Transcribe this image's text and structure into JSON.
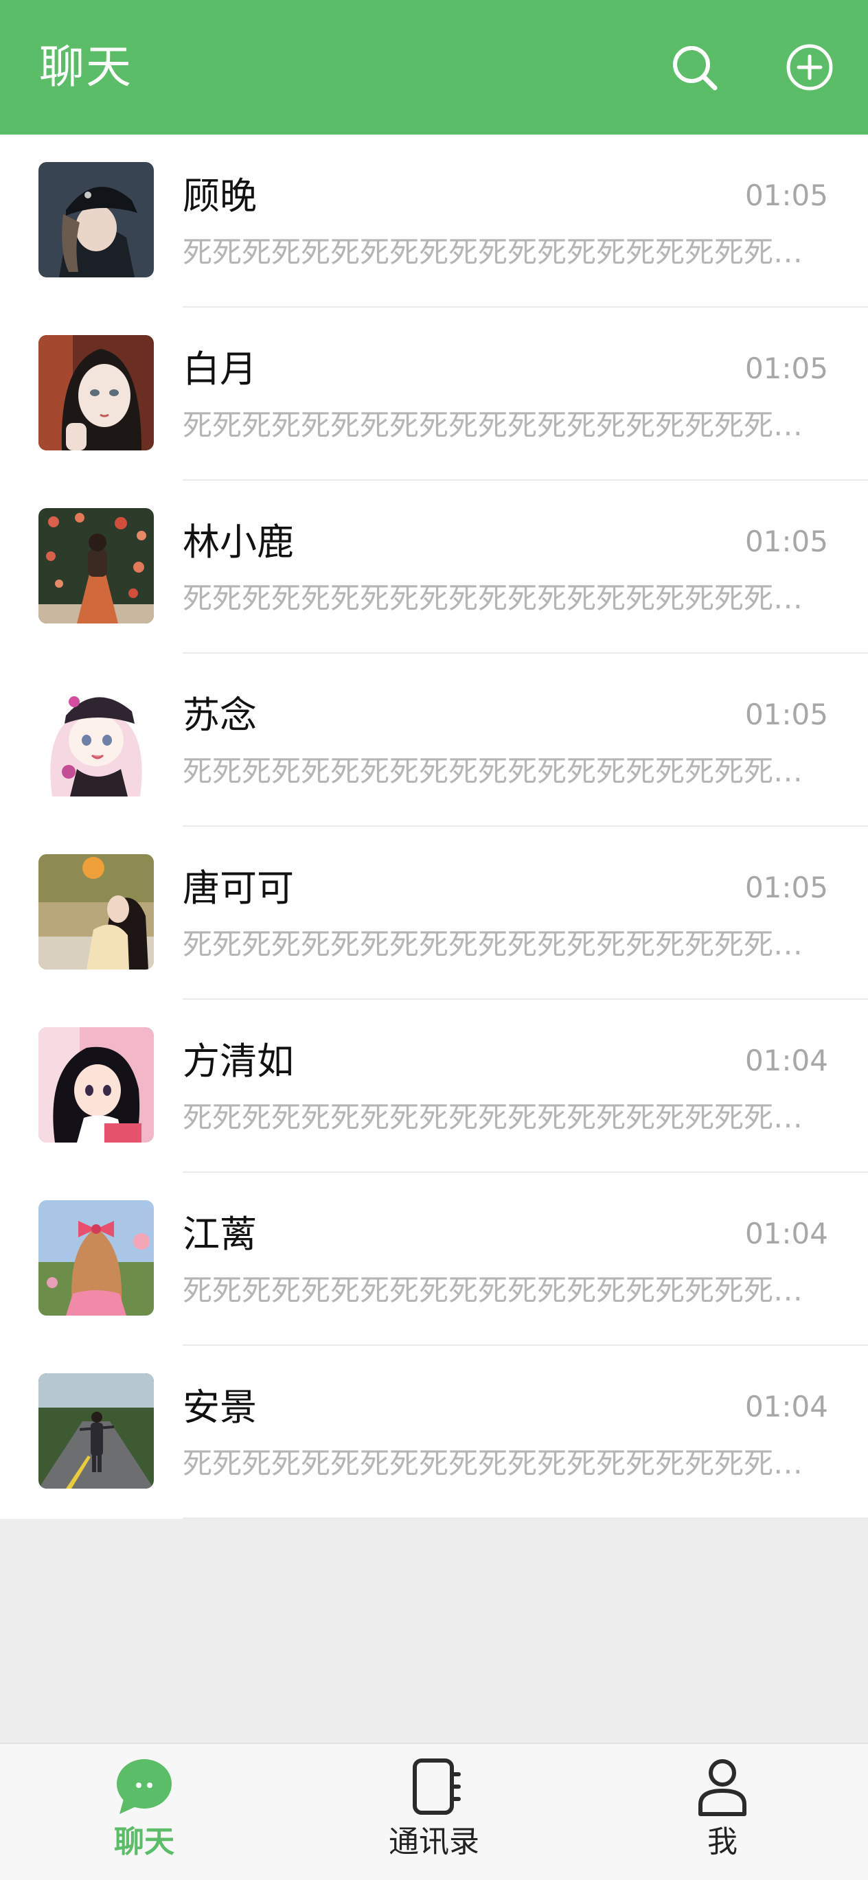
{
  "header": {
    "title": "聊天",
    "search_icon": "search-icon",
    "add_icon": "plus-circle-icon"
  },
  "chats": [
    {
      "name": "顾晚",
      "time": "01:05",
      "preview": "死死死死死死死死死死死死死死死死死死死死死死死死死死死死死死",
      "avatar": "avatar-girl-black-cap"
    },
    {
      "name": "白月",
      "time": "01:05",
      "preview": "死死死死死死死死死死死死死死死死死死死死死死死死死死死死死死",
      "avatar": "avatar-girl-illustration"
    },
    {
      "name": "林小鹿",
      "time": "01:05",
      "preview": "死死死死死死死死死死死死死死死死死死死死死死死死死死死死死死",
      "avatar": "avatar-girl-flowers"
    },
    {
      "name": "苏念",
      "time": "01:05",
      "preview": "死死死死死死死死死死死死死死死死死死死死死死死死死死死死死死",
      "avatar": "avatar-anime-girl-cap"
    },
    {
      "name": "唐可可",
      "time": "01:05",
      "preview": "死死死死死死死死死死死死死死死死死死死死死死死死死死死死死死",
      "avatar": "avatar-girl-autumn"
    },
    {
      "name": "方清如",
      "time": "01:04",
      "preview": "死死死死死死死死死死死死死死死死死死死死死死死死死死死死死死",
      "avatar": "avatar-anime-girl-pink"
    },
    {
      "name": "江蓠",
      "time": "01:04",
      "preview": "死死死死死死死死死死死死死死死死死死死死死死死死死死死死死死",
      "avatar": "avatar-girl-bow"
    },
    {
      "name": "安景",
      "time": "01:04",
      "preview": "死死死死死死死死死死死死死死死死死死死死死死死死死死死死死死",
      "avatar": "avatar-girl-road"
    }
  ],
  "tabs": [
    {
      "label": "聊天",
      "icon": "chat-bubble-icon",
      "active": true
    },
    {
      "label": "通讯录",
      "icon": "contacts-book-icon",
      "active": false
    },
    {
      "label": "我",
      "icon": "person-icon",
      "active": false
    }
  ],
  "colors": {
    "brand": "#5bbd68",
    "background": "#ededed",
    "muted_text": "#a7a7a7"
  }
}
